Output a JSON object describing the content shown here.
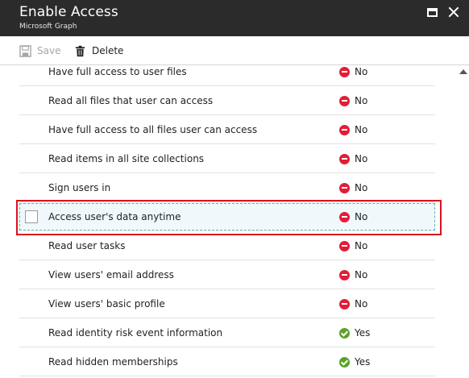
{
  "header": {
    "title": "Enable Access",
    "subtitle": "Microsoft Graph"
  },
  "toolbar": {
    "save_label": "Save",
    "delete_label": "Delete"
  },
  "permissions": [
    {
      "label": "Have full access to user files",
      "status": "No"
    },
    {
      "label": "Read all files that user can access",
      "status": "No"
    },
    {
      "label": "Have full access to all files user can access",
      "status": "No"
    },
    {
      "label": "Read items in all site collections",
      "status": "No"
    },
    {
      "label": "Sign users in",
      "status": "No"
    },
    {
      "label": "Access user's data anytime",
      "status": "No",
      "selected": true
    },
    {
      "label": "Read user tasks",
      "status": "No"
    },
    {
      "label": "View users' email address",
      "status": "No"
    },
    {
      "label": "View users' basic profile",
      "status": "No"
    },
    {
      "label": "Read identity risk event information",
      "status": "Yes"
    },
    {
      "label": "Read hidden memberships",
      "status": "Yes"
    }
  ],
  "colors": {
    "header_bg": "#2b2b2b",
    "no_status": "#e21d37",
    "yes_status": "#5ba229",
    "highlight_border": "#d9121f"
  },
  "icons": {
    "save": "save-icon",
    "delete": "trash-icon",
    "maximize": "maximize-icon",
    "close": "close-icon",
    "no": "no-entry-icon",
    "yes": "check-circle-icon"
  }
}
